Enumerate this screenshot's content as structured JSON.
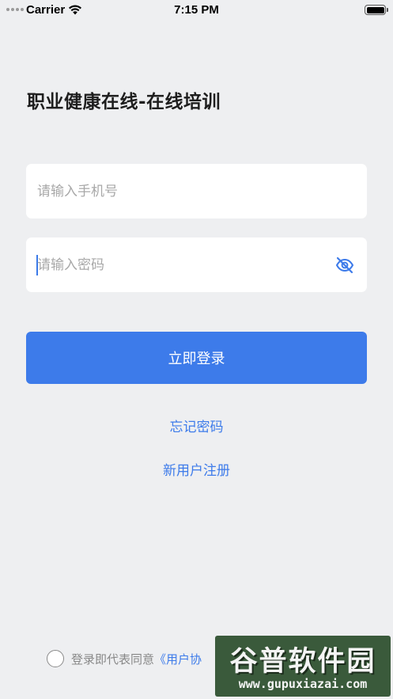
{
  "status_bar": {
    "carrier": "Carrier",
    "time": "7:15 PM"
  },
  "login": {
    "title": "职业健康在线-在线培训",
    "phone_placeholder": "请输入手机号",
    "password_placeholder": "请输入密码",
    "login_button": "立即登录",
    "forgot_password": "忘记密码",
    "register": "新用户注册"
  },
  "agreement": {
    "prefix": "登录即代表同意",
    "link": "《用户协"
  },
  "watermark": {
    "name": "谷普软件园",
    "url": "www.gupuxiazai.com"
  },
  "colors": {
    "accent": "#3d7bea",
    "background": "#eeeff1"
  },
  "icons": [
    "wifi-icon",
    "battery-icon",
    "eye-off-icon",
    "radio-icon"
  ]
}
